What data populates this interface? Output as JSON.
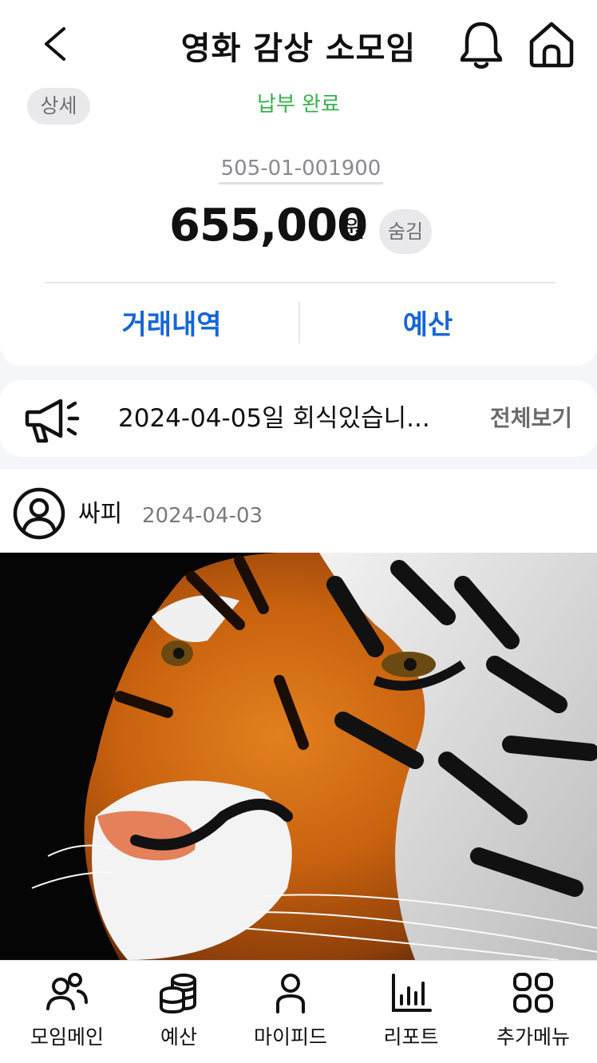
{
  "header": {
    "title": "영화 감상 소모임",
    "back_icon": "chevron-left-icon",
    "notification_icon": "bell-icon",
    "home_icon": "home-icon"
  },
  "account": {
    "detail_label": "상세",
    "payment_status": "납부 완료",
    "payment_status_color": "#36b24a",
    "account_number": "505-01-001900",
    "balance": "655,000",
    "currency": "원",
    "hide_label": "숨김",
    "tabs": [
      "거래내역",
      "예산"
    ],
    "tab_color": "#1566d6"
  },
  "notice": {
    "icon": "megaphone-icon",
    "text": "2024-04-05일 회식있습니...",
    "view_all_label": "전체보기"
  },
  "post": {
    "avatar_icon": "user-circle-icon",
    "author": "싸피",
    "date": "2024-04-03",
    "image_subject": "tiger-face-photo"
  },
  "bottom_nav": {
    "items": [
      {
        "label": "모임메인",
        "icon": "group-icon"
      },
      {
        "label": "예산",
        "icon": "coins-icon"
      },
      {
        "label": "마이피드",
        "icon": "person-icon"
      },
      {
        "label": "리포트",
        "icon": "bar-chart-icon"
      },
      {
        "label": "추가메뉴",
        "icon": "grid-menu-icon"
      }
    ]
  }
}
